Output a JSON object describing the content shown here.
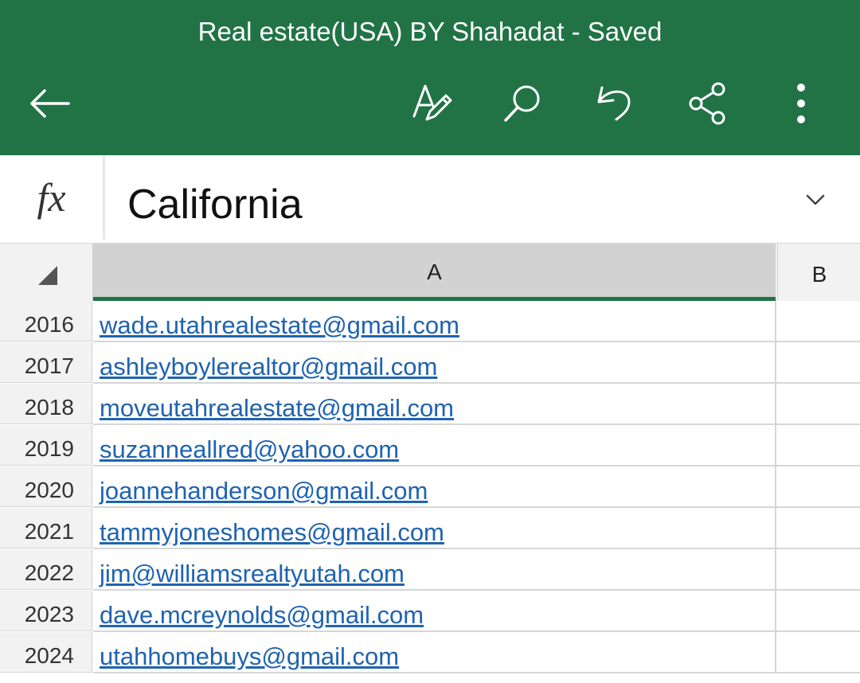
{
  "app": {
    "document_title": "Real estate(USA) BY Shahadat - Saved",
    "header_color": "#217346",
    "toolbar_icons": [
      "back-arrow-icon",
      "draw-pen-icon",
      "search-icon",
      "undo-icon",
      "share-icon",
      "more-vertical-icon"
    ]
  },
  "formula_bar": {
    "fx_label": "fx",
    "value": "California"
  },
  "grid": {
    "columns": [
      "A",
      "B"
    ],
    "selected_column": "A",
    "rows": [
      {
        "num": "2016",
        "a": "wade.utahrealestate@gmail.com"
      },
      {
        "num": "2017",
        "a": "ashleyboylerealtor@gmail.com"
      },
      {
        "num": "2018",
        "a": "moveutahrealestate@gmail.com"
      },
      {
        "num": "2019",
        "a": "suzanneallred@yahoo.com"
      },
      {
        "num": "2020",
        "a": "joannehanderson@gmail.com"
      },
      {
        "num": "2021",
        "a": "tammyjoneshomes@gmail.com"
      },
      {
        "num": "2022",
        "a": "jim@williamsrealtyutah.com"
      },
      {
        "num": "2023",
        "a": "dave.mcreynolds@gmail.com"
      },
      {
        "num": "2024",
        "a": "utahhomebuys@gmail.com"
      }
    ],
    "link_color": "#1f63b0"
  }
}
